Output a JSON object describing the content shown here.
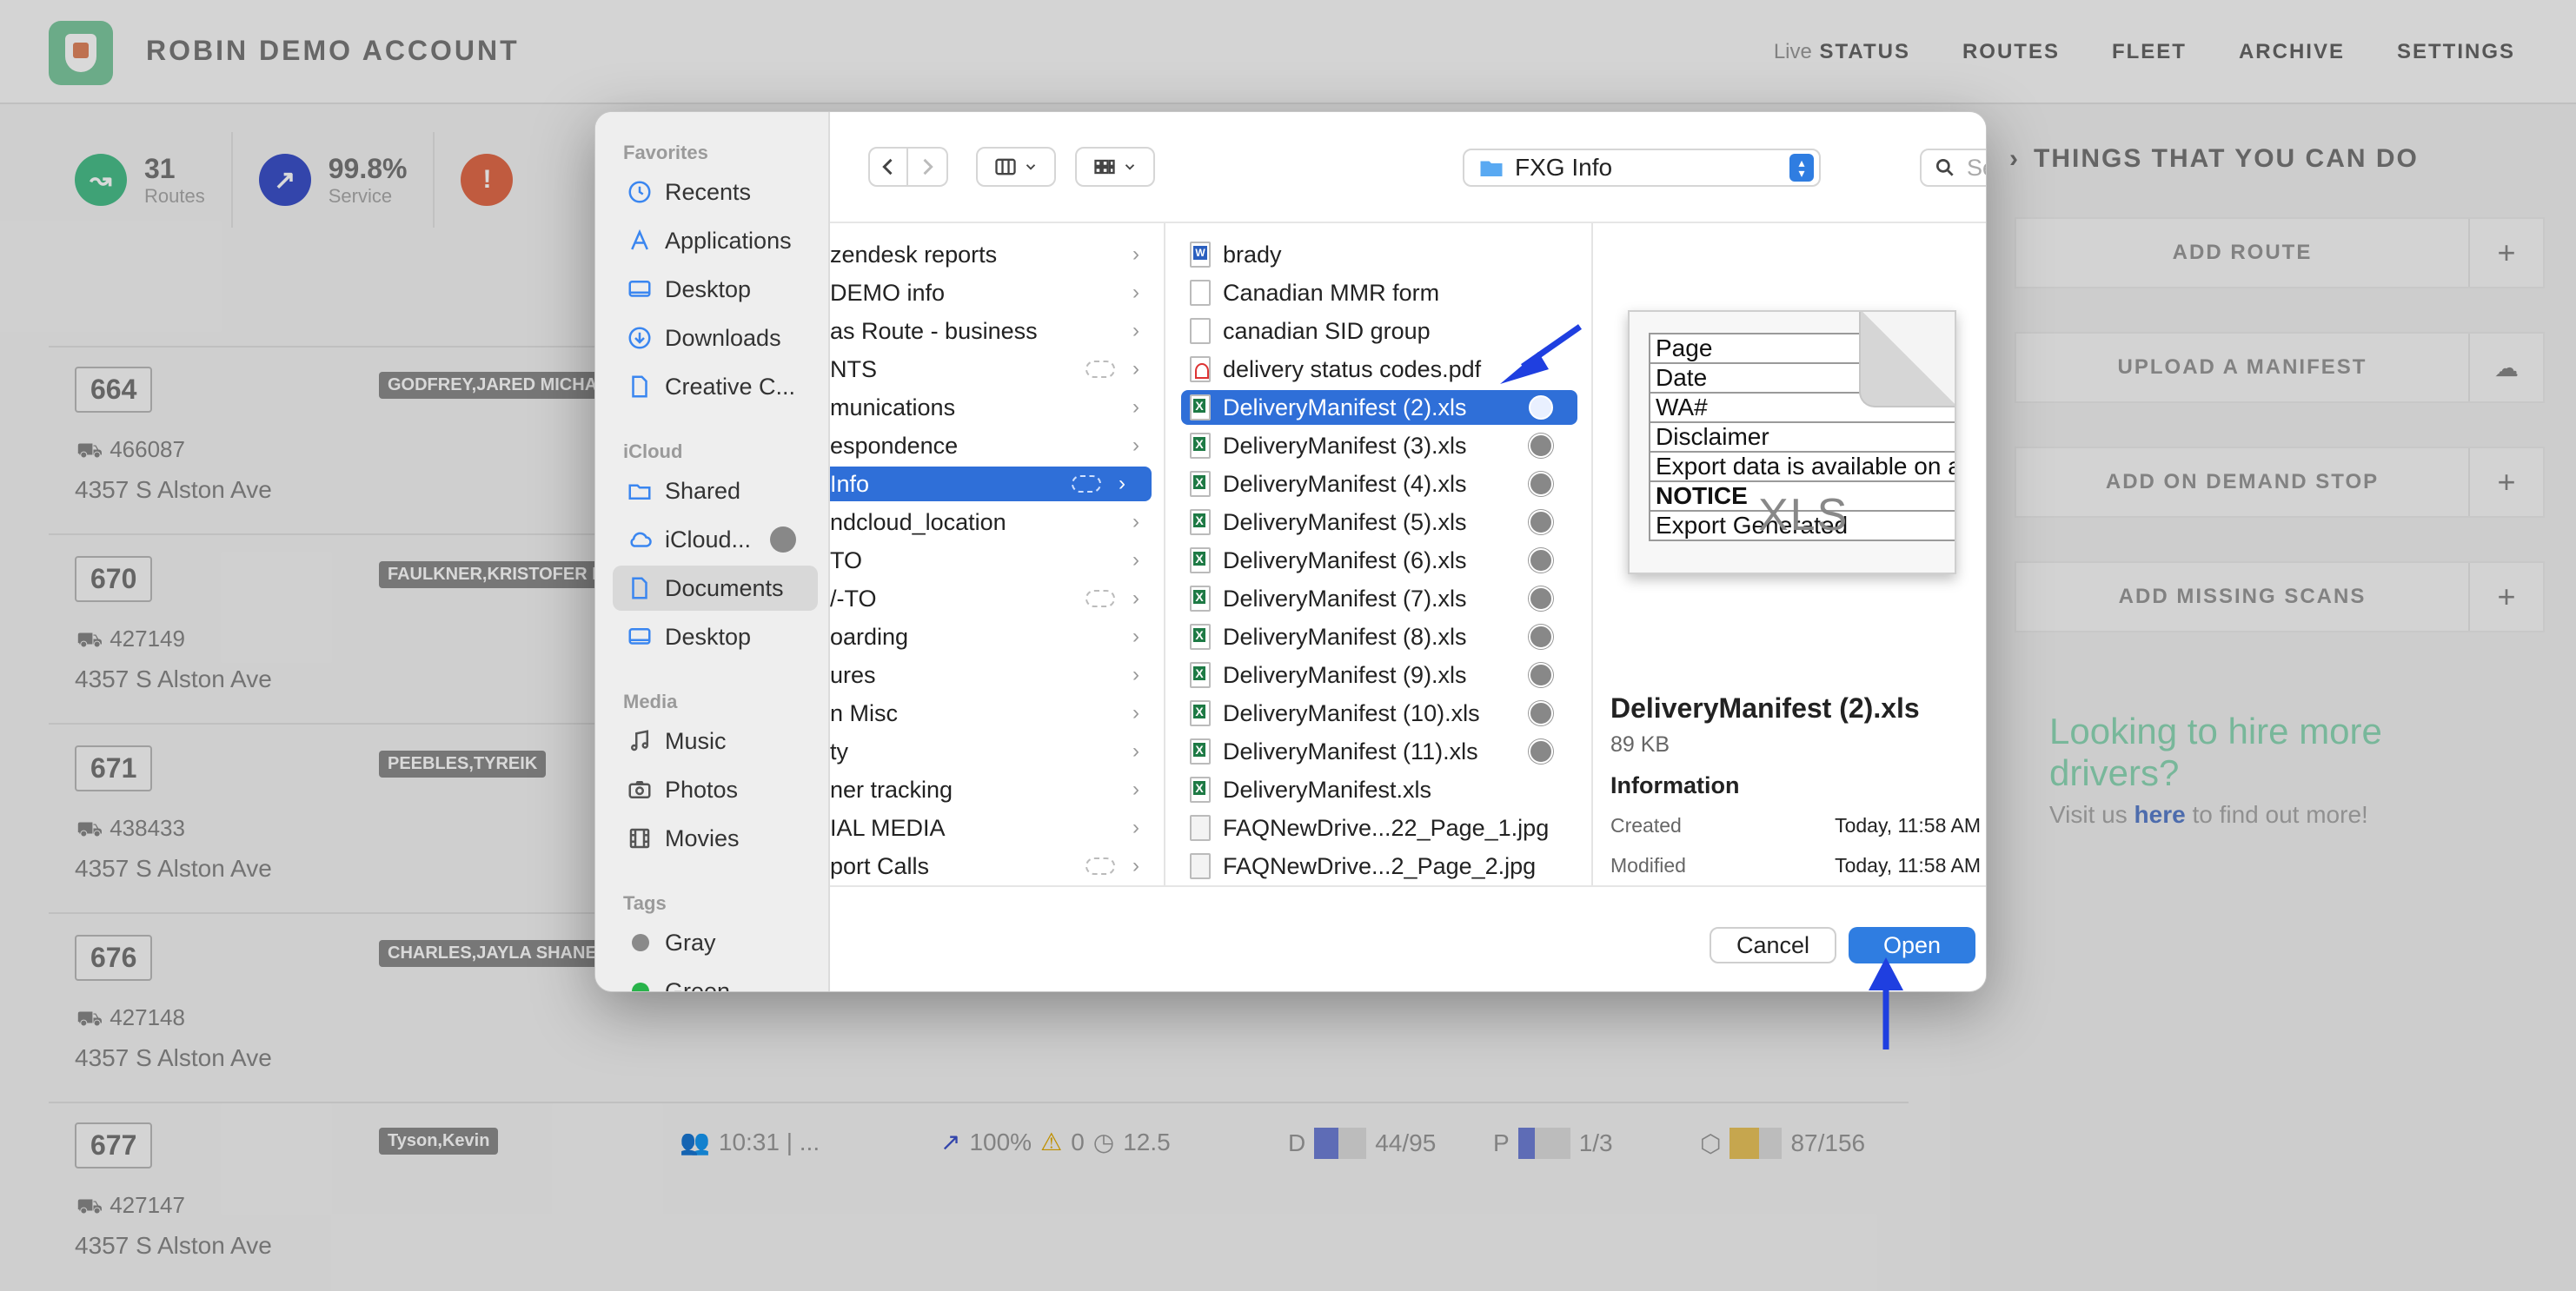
{
  "app": {
    "title": "ROBIN DEMO ACCOUNT",
    "nav": {
      "live_prefix": "Live",
      "live_status": "STATUS",
      "routes": "ROUTES",
      "fleet": "FLEET",
      "archive": "ARCHIVE",
      "settings": "SETTINGS"
    },
    "stats": [
      {
        "value": "31",
        "label": "Routes",
        "color": "#4bbf8b",
        "icon": "route-icon"
      },
      {
        "value": "99.8%",
        "label": "Service",
        "color": "#3d52c9",
        "icon": "trend-up-icon"
      },
      {
        "value": "!",
        "label": "",
        "color": "#e26b4a",
        "icon": "alert-icon"
      }
    ],
    "routes": [
      {
        "num": "664",
        "id": "466087",
        "addr": "4357 S Alston Ave",
        "driver": "GODFREY,JARED MICHA"
      },
      {
        "num": "670",
        "id": "427149",
        "addr": "4357 S Alston Ave",
        "driver": "FAULKNER,KRISTOFER B"
      },
      {
        "num": "671",
        "id": "438433",
        "addr": "4357 S Alston Ave",
        "driver": "PEEBLES,TYREIK"
      },
      {
        "num": "676",
        "id": "427148",
        "addr": "4357 S Alston Ave",
        "driver": "CHARLES,JAYLA SHANE"
      },
      {
        "num": "677",
        "id": "427147",
        "addr": "4357 S Alston Ave",
        "driver": "Tyson,Kevin"
      }
    ],
    "route677_extra": {
      "time": "10:31 | ...",
      "pct": "100%",
      "warn": "0",
      "clock": "12.5",
      "d_label": "D",
      "d_val": "44/95",
      "p_label": "P",
      "p_val": "1/3",
      "box_val": "87/156"
    },
    "things_title": "THINGS THAT YOU CAN DO",
    "actions": [
      "ADD ROUTE",
      "UPLOAD A MANIFEST",
      "ADD ON DEMAND STOP",
      "ADD MISSING SCANS"
    ],
    "hire_title": "Looking to hire more drivers?",
    "hire_pre": "Visit us",
    "hire_link": "here",
    "hire_post": "to find out more!"
  },
  "dialog": {
    "sidebar": {
      "favorites_header": "Favorites",
      "favorites": [
        "Recents",
        "Applications",
        "Desktop",
        "Downloads",
        "Creative C..."
      ],
      "icloud_header": "iCloud",
      "icloud": [
        "Shared",
        "iCloud...",
        "Documents",
        "Desktop"
      ],
      "media_header": "Media",
      "media": [
        "Music",
        "Photos",
        "Movies"
      ],
      "tags_header": "Tags",
      "tags": [
        {
          "name": "Gray",
          "color": "#8a8a8a"
        },
        {
          "name": "Green",
          "color": "#28b34a"
        }
      ]
    },
    "toolbar": {
      "folder": "FXG Info",
      "search_placeholder": "Search"
    },
    "column1": [
      "zendesk reports",
      "DEMO info",
      "as Route - business",
      "NTS",
      "munications",
      "espondence",
      "Info",
      "ndcloud_location",
      "TO",
      "/-TO",
      "oarding",
      "ures",
      "n Misc",
      "ty",
      "ner tracking",
      "IAL MEDIA",
      "port Calls"
    ],
    "column2": [
      {
        "name": "brady",
        "type": "doc"
      },
      {
        "name": "Canadian MMR form",
        "type": "blank"
      },
      {
        "name": "canadian SID group",
        "type": "blank"
      },
      {
        "name": "delivery status codes.pdf",
        "type": "pdf"
      },
      {
        "name": "DeliveryManifest (2).xls",
        "type": "xls"
      },
      {
        "name": "DeliveryManifest (3).xls",
        "type": "xls"
      },
      {
        "name": "DeliveryManifest (4).xls",
        "type": "xls"
      },
      {
        "name": "DeliveryManifest (5).xls",
        "type": "xls"
      },
      {
        "name": "DeliveryManifest (6).xls",
        "type": "xls"
      },
      {
        "name": "DeliveryManifest (7).xls",
        "type": "xls"
      },
      {
        "name": "DeliveryManifest (8).xls",
        "type": "xls"
      },
      {
        "name": "DeliveryManifest (9).xls",
        "type": "xls"
      },
      {
        "name": "DeliveryManifest (10).xls",
        "type": "xls"
      },
      {
        "name": "DeliveryManifest (11).xls",
        "type": "xls"
      },
      {
        "name": "DeliveryManifest.xls",
        "type": "xls"
      },
      {
        "name": "FAQNewDrive...22_Page_1.jpg",
        "type": "img"
      },
      {
        "name": "FAQNewDrive...2_Page_2.jpg",
        "type": "img"
      }
    ],
    "preview": {
      "sheet_rows": [
        "Page",
        "Date",
        "WA#",
        "Disclaimer",
        "Export data is available on ado",
        "NOTICE",
        "Export Generated"
      ],
      "sheet_badge": "XLS",
      "name": "DeliveryManifest (2).xls",
      "size": "89 KB",
      "info_header": "Information",
      "created_label": "Created",
      "created_value": "Today, 11:58 AM",
      "modified_label": "Modified",
      "modified_value": "Today, 11:58 AM"
    },
    "buttons": {
      "cancel": "Cancel",
      "open": "Open"
    }
  },
  "colors": {
    "accent": "#2f7de1",
    "selection": "#2f6fd8",
    "annotation_arrow": "#1f3fe0"
  }
}
